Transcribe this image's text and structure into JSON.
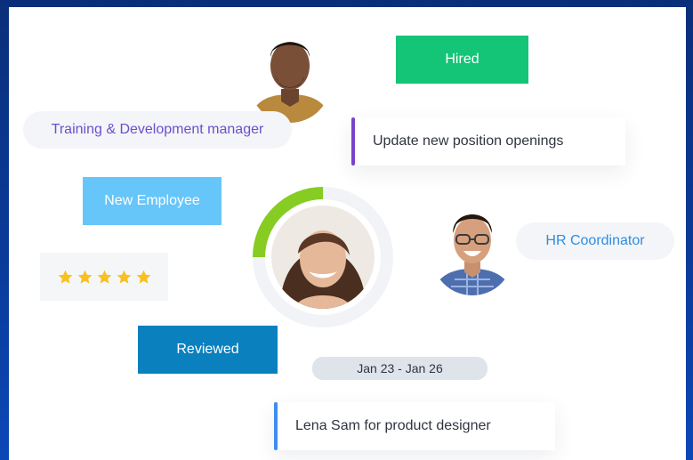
{
  "roles": {
    "training_manager": "Training & Development manager",
    "hr_coordinator": "HR Coordinator"
  },
  "tags": {
    "hired": "Hired",
    "new_employee": "New Employee",
    "reviewed": "Reviewed"
  },
  "tasks": {
    "update_openings": "Update new position openings",
    "lena_sam": "Lena Sam for product designer"
  },
  "date_range": "Jan 23 - Jan 26",
  "rating": {
    "stars": 5,
    "max": 5
  },
  "profile_progress": 0.25,
  "colors": {
    "hired": "#14c577",
    "new_employee": "#66c6f9",
    "reviewed": "#0a80bf",
    "role_text_purple": "#6d4fcc",
    "role_text_blue": "#2f8de0",
    "task_bar_purple": "#7a43c9",
    "task_bar_blue": "#3d8ef0",
    "progress_green": "#86cc22",
    "star_gold": "#f8c021"
  },
  "icons": [
    "star-icon"
  ]
}
